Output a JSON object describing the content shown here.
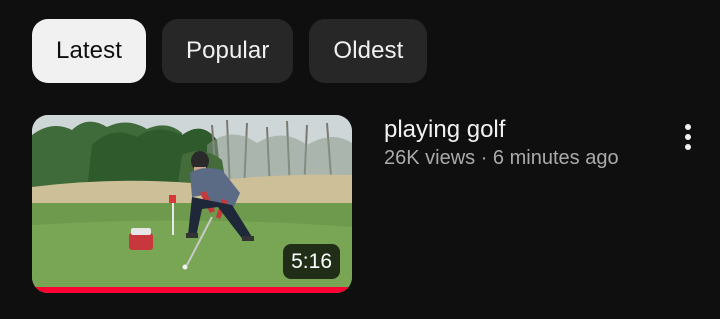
{
  "filters": [
    {
      "label": "Latest",
      "selected": true
    },
    {
      "label": "Popular",
      "selected": false
    },
    {
      "label": "Oldest",
      "selected": false
    }
  ],
  "video": {
    "title": "playing golf",
    "stats": "26K views · 6 minutes ago",
    "duration": "5:16",
    "watch_progress": 1.0,
    "menu_icon": "more-vertical-icon"
  },
  "colors": {
    "background": "#0f0f0f",
    "chip_active_bg": "#f1f1f1",
    "chip_bg": "#272727",
    "progress_red": "#ff0033",
    "secondary_text": "#aaaaaa"
  }
}
